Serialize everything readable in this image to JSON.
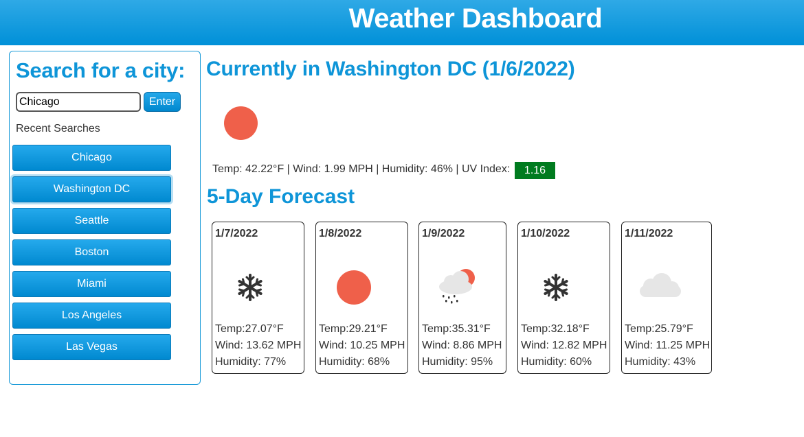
{
  "header": {
    "title": "Weather Dashboard"
  },
  "sidebar": {
    "title": "Search for a city:",
    "search_value": "Chicago",
    "enter_label": "Enter",
    "recent_label": "Recent Searches",
    "cities": [
      "Chicago",
      "Washington DC",
      "Seattle",
      "Boston",
      "Miami",
      "Los Angeles",
      "Las Vegas"
    ]
  },
  "current": {
    "title": "Currently in Washington DC (1/6/2022)",
    "icon": "sun-icon",
    "stats": "Temp: 42.22°F | Wind: 1.99 MPH | Humidity: 46% | UV Index:",
    "uv": "1.16",
    "uv_color": "#007b1f"
  },
  "forecast": {
    "title": "5-Day Forecast",
    "days": [
      {
        "date": "1/7/2022",
        "icon": "snowflake-icon",
        "temp": "Temp:27.07°F",
        "wind": "Wind: 13.62 MPH",
        "humidity": "Humidity: 77%"
      },
      {
        "date": "1/8/2022",
        "icon": "sun-icon",
        "temp": "Temp:29.21°F",
        "wind": "Wind: 10.25 MPH",
        "humidity": "Humidity: 68%"
      },
      {
        "date": "1/9/2022",
        "icon": "sun-rain-cloud-icon",
        "temp": "Temp:35.31°F",
        "wind": "Wind: 8.86 MPH",
        "humidity": "Humidity: 95%"
      },
      {
        "date": "1/10/2022",
        "icon": "snowflake-icon",
        "temp": "Temp:32.18°F",
        "wind": "Wind: 12.82 MPH",
        "humidity": "Humidity: 60%"
      },
      {
        "date": "1/11/2022",
        "icon": "cloud-icon",
        "temp": "Temp:25.79°F",
        "wind": "Wind: 11.25 MPH",
        "humidity": "Humidity: 43%"
      }
    ]
  },
  "colors": {
    "accent": "#0e95d8",
    "sun": "#ef604a",
    "cloud": "#e6e6e6"
  }
}
